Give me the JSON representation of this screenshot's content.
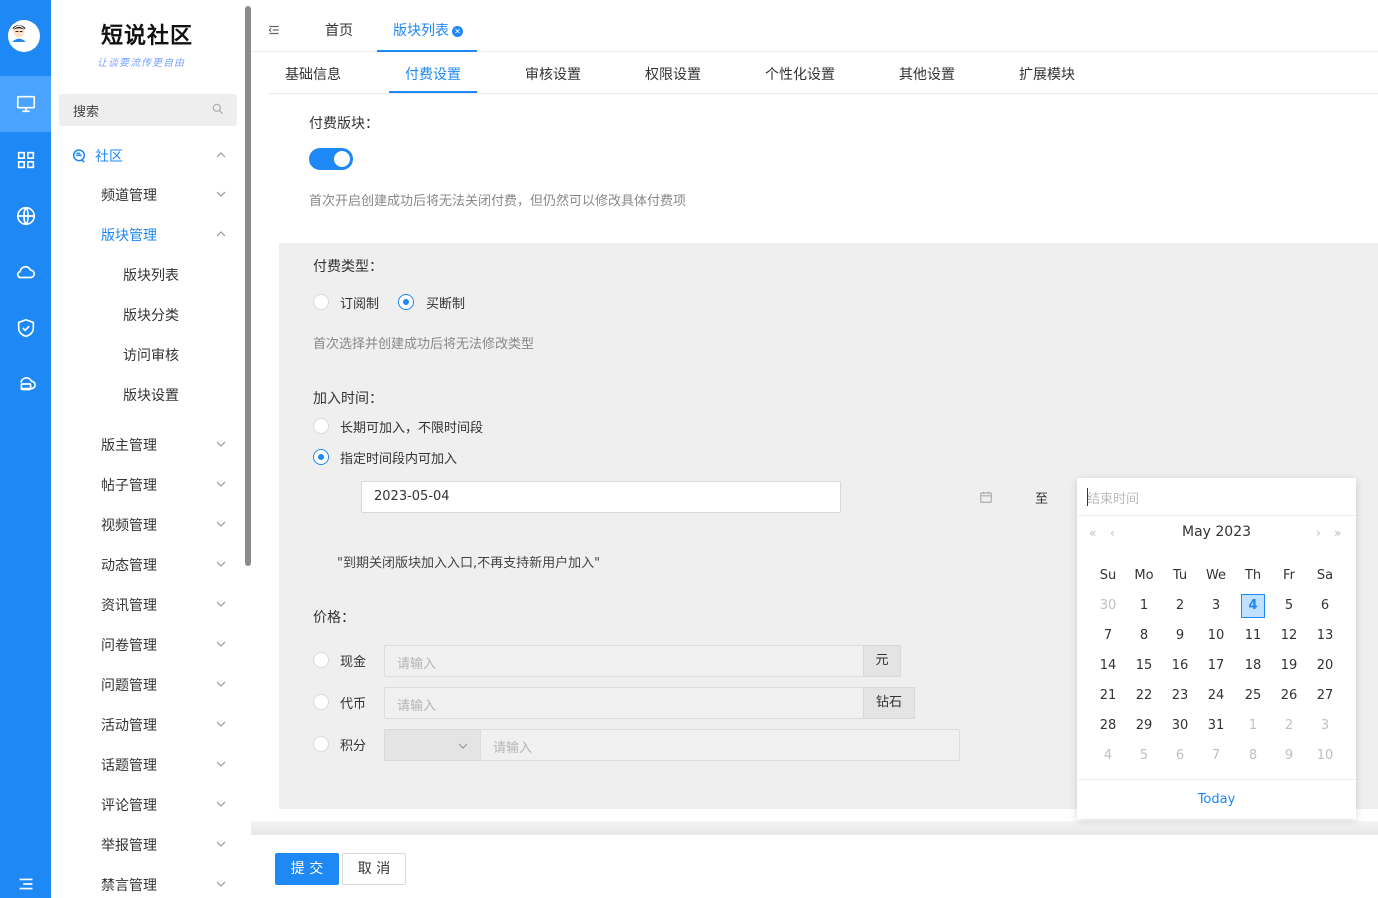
{
  "brand": {
    "title": "短说社区",
    "subtitle": "让谈要流传更自由"
  },
  "sidebar": {
    "search_placeholder": "搜索",
    "root_label": "社区",
    "items": [
      "频道管理",
      "版块管理",
      "版主管理",
      "帖子管理",
      "视频管理",
      "动态管理",
      "资讯管理",
      "问卷管理",
      "问题管理",
      "活动管理",
      "话题管理",
      "评论管理",
      "举报管理",
      "禁言管理"
    ],
    "sub_items": [
      "版块列表",
      "版块分类",
      "访问审核",
      "版块设置"
    ]
  },
  "top_tabs": [
    "首页",
    "版块列表"
  ],
  "sub_tabs": [
    "基础信息",
    "付费设置",
    "审核设置",
    "权限设置",
    "个性化设置",
    "其他设置",
    "扩展模块"
  ],
  "form": {
    "paid_label": "付费版块：",
    "paid_enabled": true,
    "paid_hint": "首次开启创建成功后将无法关闭付费，但仍然可以修改具体付费项",
    "type_label": "付费类型：",
    "type_options": [
      "订阅制",
      "买断制"
    ],
    "type_selected": "买断制",
    "type_hint": "首次选择并创建成功后将无法修改类型",
    "join_label": "加入时间：",
    "join_options": [
      "长期可加入，不限时间段",
      "指定时间段内可加入"
    ],
    "join_selected": "指定时间段内可加入",
    "start_date": "2023-05-04",
    "range_separator": "至",
    "end_placeholder": "结束时间",
    "expire_hint": "\"到期关闭版块加入入口,不再支持新用户加入\"",
    "price_label": "价格：",
    "price_options": [
      {
        "label": "现金",
        "placeholder": "请输入",
        "unit": "元"
      },
      {
        "label": "代币",
        "placeholder": "请输入",
        "unit": "钻石"
      },
      {
        "label": "积分",
        "placeholder": "请输入",
        "unit": ""
      }
    ]
  },
  "datepicker": {
    "month_label": "May 2023",
    "weekdays": [
      "Su",
      "Mo",
      "Tu",
      "We",
      "Th",
      "Fr",
      "Sa"
    ],
    "weeks": [
      [
        "30",
        "1",
        "2",
        "3",
        "4",
        "5",
        "6"
      ],
      [
        "7",
        "8",
        "9",
        "10",
        "11",
        "12",
        "13"
      ],
      [
        "14",
        "15",
        "16",
        "17",
        "18",
        "19",
        "20"
      ],
      [
        "21",
        "22",
        "23",
        "24",
        "25",
        "26",
        "27"
      ],
      [
        "28",
        "29",
        "30",
        "31",
        "1",
        "2",
        "3"
      ],
      [
        "4",
        "5",
        "6",
        "7",
        "8",
        "9",
        "10"
      ]
    ],
    "selected_day": "4",
    "today_label": "Today"
  },
  "buttons": {
    "submit": "提 交",
    "cancel": "取 消"
  },
  "colors": {
    "primary": "#1e88f5",
    "rail": "#1e88f5"
  }
}
